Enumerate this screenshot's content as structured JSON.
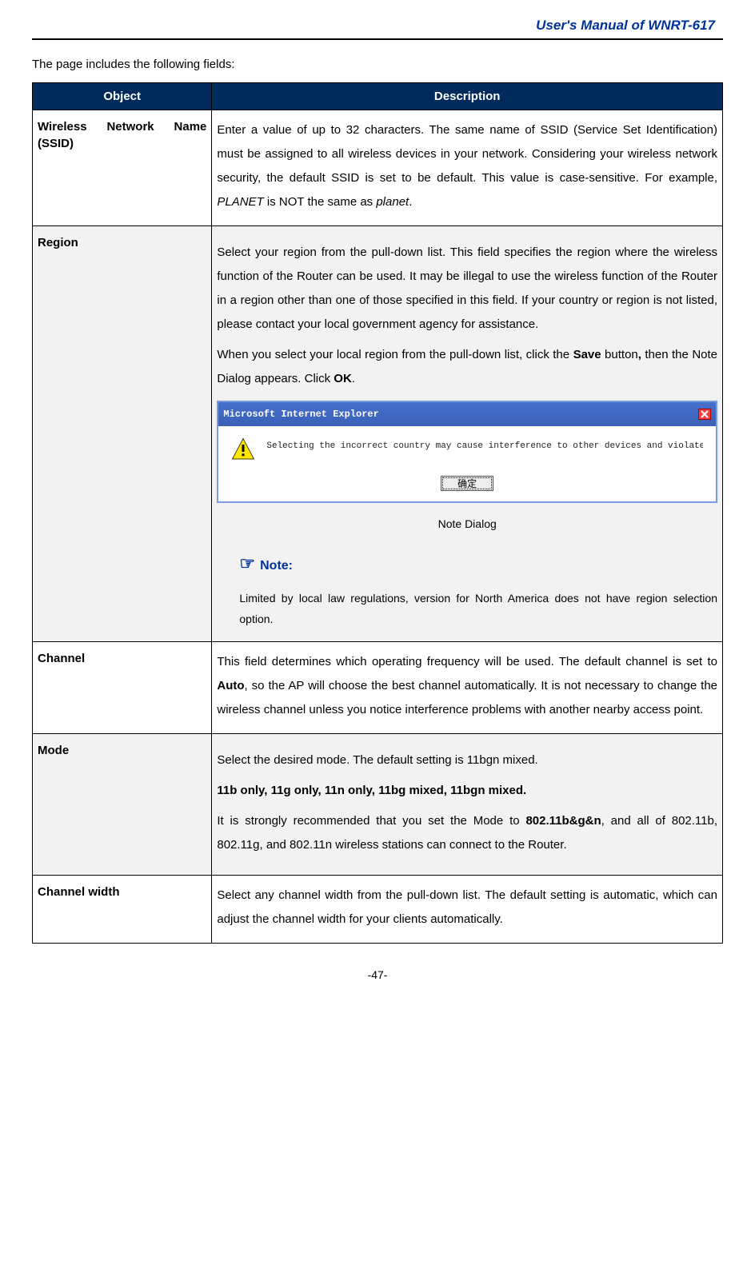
{
  "header": {
    "title": "User's Manual of WNRT-617"
  },
  "intro": "The page includes the following fields:",
  "table": {
    "col_object": "Object",
    "col_description": "Description"
  },
  "rows": {
    "ssid": {
      "object_l1": "Wireless Network Name",
      "object_l2": "(SSID)",
      "desc_p1_a": "Enter a value of up to 32 characters. The same name of SSID (Service Set Identification) must be assigned to all wireless devices in your network. Considering your wireless network security, the default SSID is set to be default. This value is case-sensitive. For example, ",
      "desc_em1": "PLANET",
      "desc_p1_b": " is NOT the same as ",
      "desc_em2": "planet",
      "desc_p1_c": "."
    },
    "region": {
      "object": "Region",
      "desc_p1": "Select your region from the pull-down list. This field specifies the region where the wireless function of the Router can be used. It may be illegal to use the wireless function of the Router in a region other than one of those specified in this field. If your country or region is not listed, please contact your local government agency for assistance.",
      "desc_p2_a": "When you select your local region from the pull-down list, click the ",
      "desc_p2_save": "Save",
      "desc_p2_b": " button",
      "desc_p2_comma": ",",
      "desc_p2_c": " then the Note Dialog appears. Click ",
      "desc_p2_ok": "OK",
      "desc_p2_d": ".",
      "dialog": {
        "title": "Microsoft Internet Explorer",
        "text": "Selecting the incorrect country may cause interference to other devices and violate the applicable law.",
        "button": "确定"
      },
      "caption": "Note Dialog",
      "note": {
        "head": "Note:",
        "body": "Limited by local law regulations, version for North America does not have region selection option."
      }
    },
    "channel": {
      "object": "Channel",
      "desc_a": "This field determines which operating frequency will be used. The default channel is set to ",
      "desc_auto": "Auto",
      "desc_b": ", so the AP will choose the best channel automatically. It is not necessary to change the wireless channel unless you notice interference problems with another nearby access point."
    },
    "mode": {
      "object": "Mode",
      "desc_p1": "Select the desired mode. The default setting is 11bgn mixed.",
      "list": "11b only, 11g only, 11n only, 11bg mixed, 11bgn mixed.",
      "desc_p2_a": "It is strongly recommended that you set the Mode to ",
      "desc_p2_mode": "802.11b&g&n",
      "desc_p2_b": ", and all of 802.11b, 802.11g, and 802.11n wireless stations can connect to the Router."
    },
    "cw": {
      "object": "Channel width",
      "desc": "Select any channel width from the pull-down list. The default setting is automatic, which can adjust the channel width for your clients automatically."
    }
  },
  "footer": "-47-"
}
